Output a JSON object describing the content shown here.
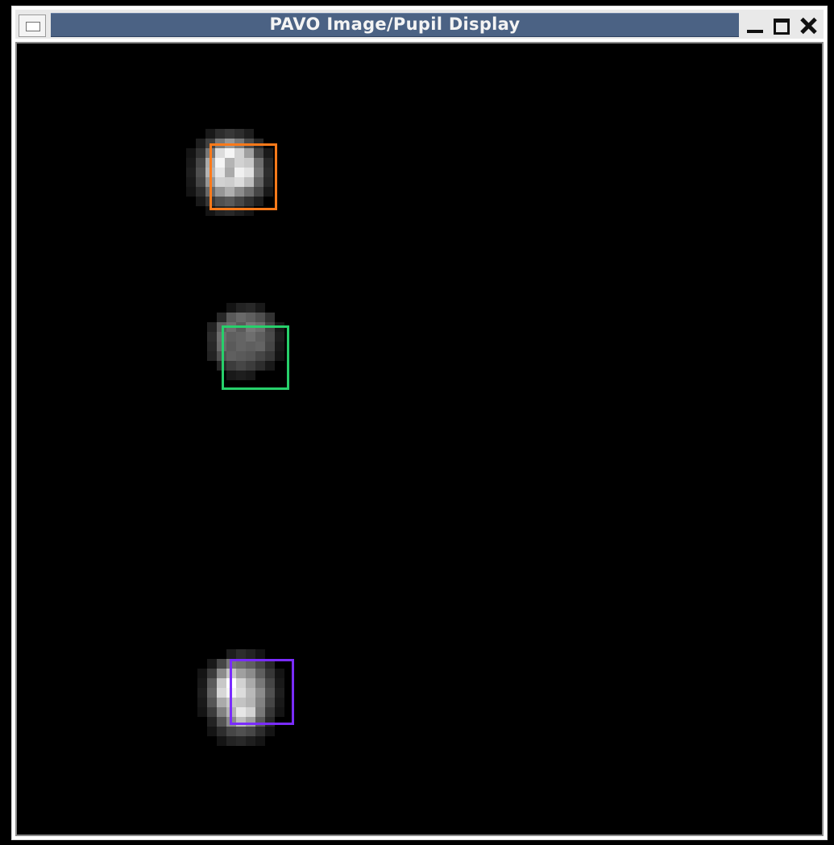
{
  "window": {
    "title": "PAVO Image/Pupil Display",
    "controls": {
      "system_menu": "window-menu-icon",
      "minimize": "minimize-icon",
      "maximize": "maximize-icon",
      "close": "close-icon"
    }
  },
  "display": {
    "background_color": "#000000",
    "roi_boxes": [
      {
        "name": "upper-roi-box",
        "color": "#ff7a1a"
      },
      {
        "name": "middle-roi-box",
        "color": "#27d06b"
      },
      {
        "name": "lower-roi-box",
        "color": "#7a2cff"
      }
    ]
  }
}
